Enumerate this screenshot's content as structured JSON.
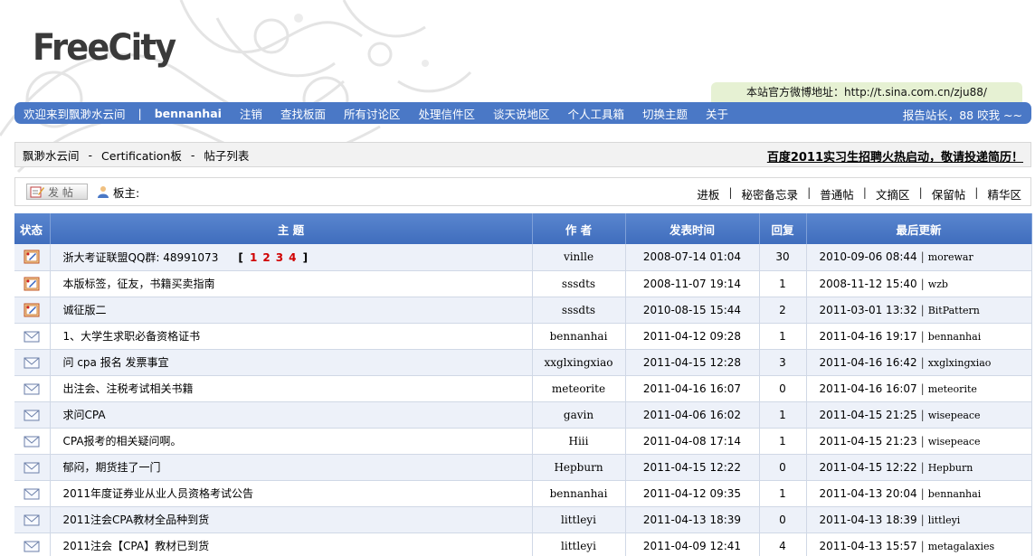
{
  "logo": "FreeCity",
  "weibo_notice": "本站官方微博地址：http://t.sina.com.cn/zju88/",
  "nav": {
    "welcome": "欢迎来到飘渺水云间",
    "separator": "|",
    "username": "bennanhai",
    "items": [
      "注销",
      "查找板面",
      "所有讨论区",
      "处理信件区",
      "谈天说地区",
      "个人工具箱",
      "切换主题",
      "关于"
    ],
    "right_text": "报告站长，88 咬我 ~~"
  },
  "breadcrumb": {
    "items": [
      "飘渺水云间",
      "Certification板",
      "帖子列表"
    ],
    "separator": "-",
    "ad_text": "百度2011实习生招聘火热启动，敬请投递简历！"
  },
  "toolbar": {
    "post_button": "发 帖",
    "moderator_label": "板主:",
    "links": [
      "进板",
      "秘密备忘录",
      "普通帖",
      "文摘区",
      "保留帖",
      "精华区"
    ],
    "link_separator": "|"
  },
  "table": {
    "headers": [
      "状态",
      "主 题",
      "作 者",
      "发表时间",
      "回复",
      "最后更新"
    ],
    "rows": [
      {
        "icon": "pinned",
        "title": "浙大考证联盟QQ群: 48991073",
        "pages": [
          "1",
          "2",
          "3",
          "4"
        ],
        "author": "vinlle",
        "time": "2008-07-14 01:04",
        "replies": "30",
        "last_time": "2010-09-06 08:44",
        "last_user": "morewar"
      },
      {
        "icon": "pinned",
        "title": "本版标签，征友，书籍买卖指南",
        "author": "sssdts",
        "time": "2008-11-07 19:14",
        "replies": "1",
        "last_time": "2008-11-12 15:40",
        "last_user": "wzb"
      },
      {
        "icon": "pinned",
        "title": "诚征版二",
        "author": "sssdts",
        "time": "2010-08-15 15:44",
        "replies": "2",
        "last_time": "2011-03-01 13:32",
        "last_user": "BitPattern"
      },
      {
        "icon": "normal",
        "title": "1、大学生求职必备资格证书",
        "author": "bennanhai",
        "time": "2011-04-12 09:28",
        "replies": "1",
        "last_time": "2011-04-16 19:17",
        "last_user": "bennanhai"
      },
      {
        "icon": "normal",
        "title": "问 cpa 报名 发票事宜",
        "author": "xxglxingxiao",
        "time": "2011-04-15 12:28",
        "replies": "3",
        "last_time": "2011-04-16 16:42",
        "last_user": "xxglxingxiao"
      },
      {
        "icon": "normal",
        "title": "出注会、注税考试相关书籍",
        "author": "meteorite",
        "time": "2011-04-16 16:07",
        "replies": "0",
        "last_time": "2011-04-16 16:07",
        "last_user": "meteorite"
      },
      {
        "icon": "normal",
        "title": "求问CPA",
        "author": "gavin",
        "time": "2011-04-06 16:02",
        "replies": "1",
        "last_time": "2011-04-15 21:25",
        "last_user": "wisepeace"
      },
      {
        "icon": "normal",
        "title": "CPA报考的相关疑问啊。",
        "author": "Hiii",
        "time": "2011-04-08 17:14",
        "replies": "1",
        "last_time": "2011-04-15 21:23",
        "last_user": "wisepeace"
      },
      {
        "icon": "normal",
        "title": "郁闷，期货挂了一门",
        "author": "Hepburn",
        "time": "2011-04-15 12:22",
        "replies": "0",
        "last_time": "2011-04-15 12:22",
        "last_user": "Hepburn"
      },
      {
        "icon": "normal",
        "title": "2011年度证券业从业人员资格考试公告",
        "author": "bennanhai",
        "time": "2011-04-12 09:35",
        "replies": "1",
        "last_time": "2011-04-13 20:04",
        "last_user": "bennanhai"
      },
      {
        "icon": "normal",
        "title": "2011注会CPA教材全品种到货",
        "author": "littleyi",
        "time": "2011-04-13 18:39",
        "replies": "0",
        "last_time": "2011-04-13 18:39",
        "last_user": "littleyi"
      },
      {
        "icon": "normal",
        "title": "2011注会【CPA】教材已到货",
        "author": "littleyi",
        "time": "2011-04-09 12:41",
        "replies": "4",
        "last_time": "2011-04-13 15:57",
        "last_user": "metagalaxies"
      }
    ]
  },
  "colors": {
    "nav_blue": "#4a78c6",
    "header_blue": "#4670c0",
    "row_alt": "#edf1f9",
    "page_red": "#d00000",
    "weibo_green": "#e6f1d3"
  }
}
